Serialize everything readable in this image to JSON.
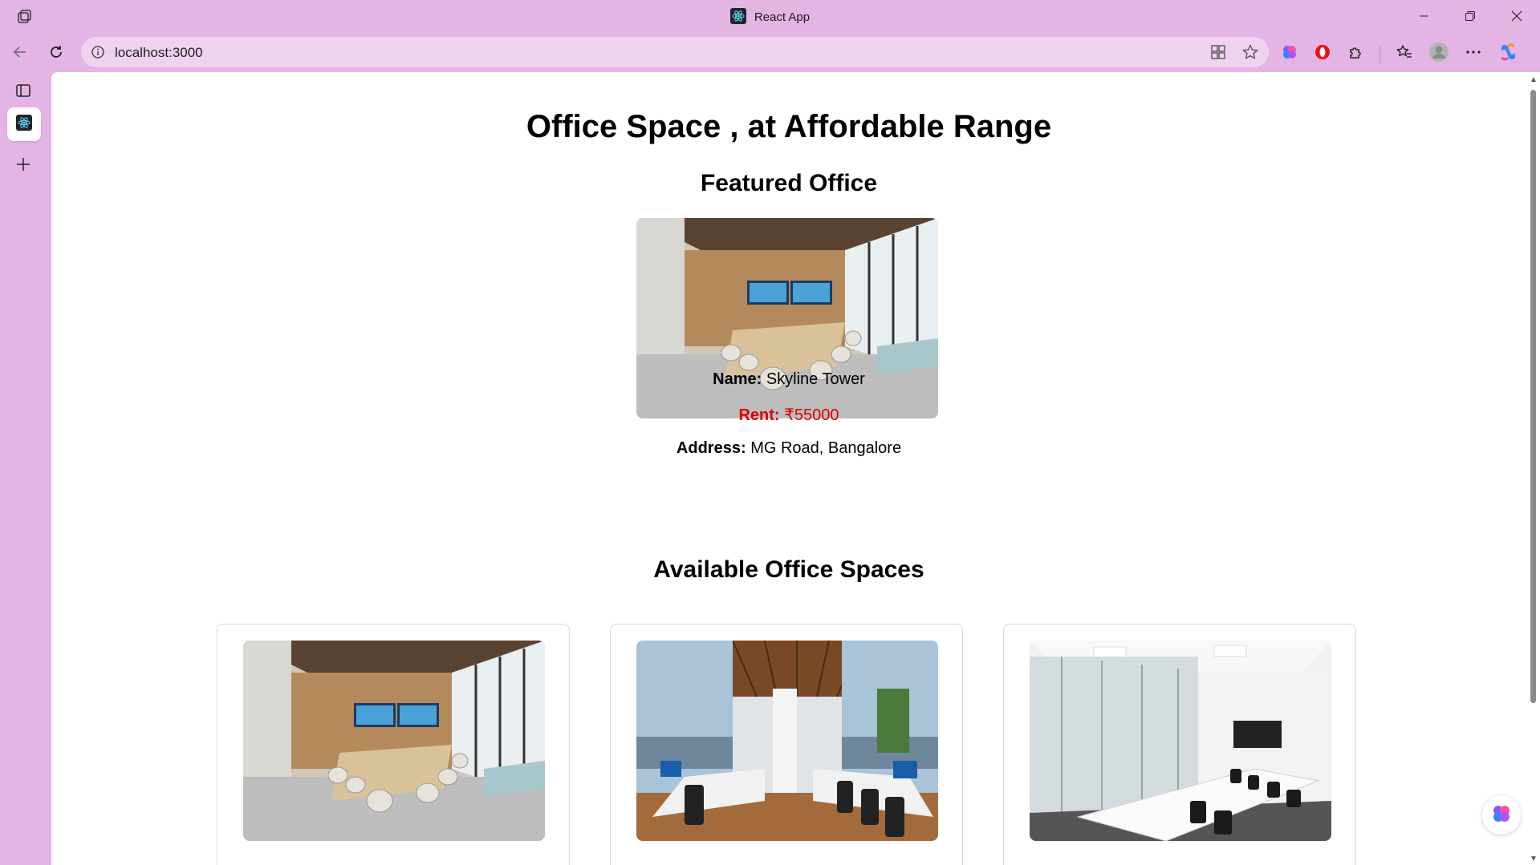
{
  "browser": {
    "tab_title": "React App",
    "url": "localhost:3000"
  },
  "page": {
    "title": "Office Space , at Affordable Range",
    "featured_heading": "Featured Office",
    "featured": {
      "name_label": "Name:",
      "name_value": "Skyline Tower",
      "rent_label": "Rent:",
      "rent_value": "₹55000",
      "address_label": "Address:",
      "address_value": "MG Road, Bangalore"
    },
    "available_heading": "Available Office Spaces"
  },
  "colors": {
    "browser_bg": "#e4b4e4",
    "rent_color": "#e00000"
  }
}
